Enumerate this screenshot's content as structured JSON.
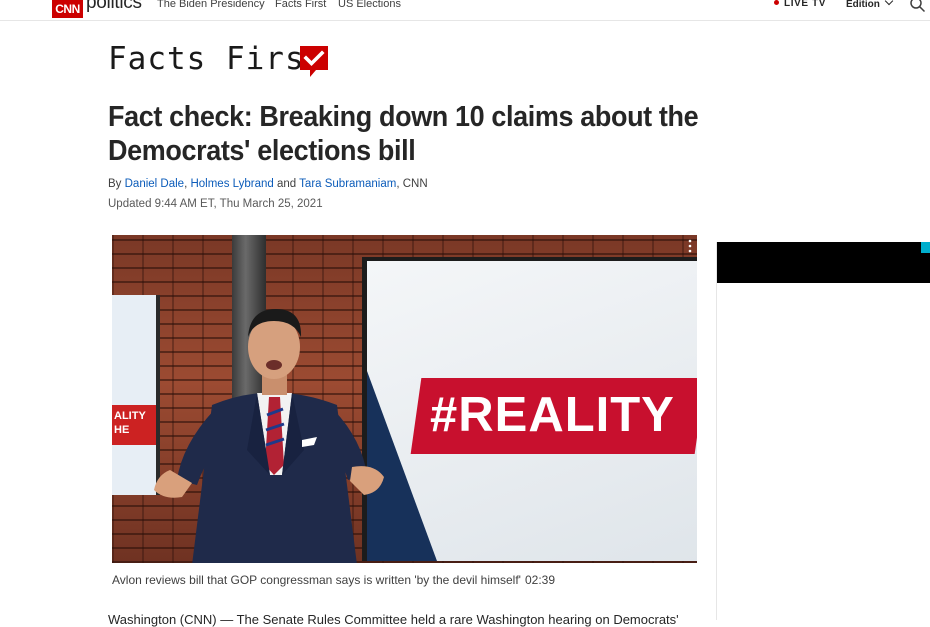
{
  "topnav": {
    "logo_text": "CNN",
    "section_word": "politics",
    "links": [
      "The Biden Presidency",
      "Facts First",
      "US Elections"
    ],
    "live_tv_label": "LIVE TV",
    "edition_label": "Edition",
    "search_icon": "search-icon"
  },
  "banner": {
    "facts_first_label": "Facts First",
    "badge_icon": "checkmark-badge-icon",
    "badge_color": "#cc0000"
  },
  "article": {
    "headline": "Fact check: Breaking down 10 claims about the Democrats' elections bill",
    "byline_prefix": "By",
    "authors": [
      "Daniel Dale",
      "Holmes Lybrand",
      "Tara Subramaniam"
    ],
    "byline_and": "and",
    "byline_suffix": ", CNN",
    "updated": "Updated 9:44 AM ET, Thu March 25, 2021",
    "body_start": "Washington (CNN) — The Senate Rules Committee held a rare Washington hearing on Democrats'"
  },
  "video": {
    "screen_text": "#REALITY",
    "left_screen_text": "ALITY",
    "left_screen_text2": "HE",
    "caption": "Avlon reviews bill that GOP congressman says is written 'by the devil himself'",
    "duration": "02:39",
    "menu_icon": "vertical-dots-icon"
  },
  "colors": {
    "brand_red": "#cc0000",
    "link_blue": "#0c5cba",
    "reality_red": "#c8102e"
  }
}
